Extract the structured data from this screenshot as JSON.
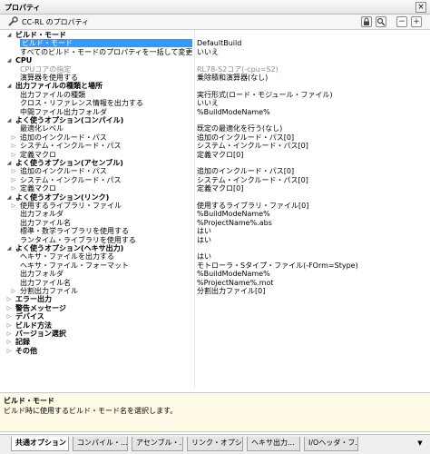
{
  "window": {
    "title": "プロパティ"
  },
  "toolbar": {
    "title": "CC-RL のプロパティ"
  },
  "rows": [
    {
      "type": "cat",
      "name": "ビルド・モード",
      "value": ""
    },
    {
      "type": "sel",
      "name": "ビルド・モード",
      "value": "DefaultBuild"
    },
    {
      "type": "item",
      "name": "すべてのビルド・モードのプロパティを一括して変更する",
      "value": "いいえ"
    },
    {
      "type": "cat",
      "name": "CPU",
      "value": ""
    },
    {
      "type": "grey",
      "name": "CPUコアの指定",
      "value": "RL78-S2コア(-cpu=S2)"
    },
    {
      "type": "item",
      "name": "演算器を使用する",
      "value": "乗除積和演算器(なし)"
    },
    {
      "type": "cat",
      "name": "出力ファイルの種類と場所",
      "value": ""
    },
    {
      "type": "item",
      "name": "出力ファイルの種類",
      "value": "実行形式(ロード・モジュール・ファイル)"
    },
    {
      "type": "item",
      "name": "クロス・リファレンス情報を出力する",
      "value": "いいえ"
    },
    {
      "type": "item",
      "name": "中間ファイル出力フォルダ",
      "value": "%BuildModeName%"
    },
    {
      "type": "cat",
      "name": "よく使うオプション(コンパイル)",
      "value": ""
    },
    {
      "type": "item",
      "name": "最適化レベル",
      "value": "既定の最適化を行う(なし)"
    },
    {
      "type": "child",
      "name": "追加のインクルード・パス",
      "value": "追加のインクルード・パス[0]"
    },
    {
      "type": "child",
      "name": "システム・インクルード・パス",
      "value": "システム・インクルード・パス[0]"
    },
    {
      "type": "child",
      "name": "定義マクロ",
      "value": "定義マクロ[0]"
    },
    {
      "type": "cat",
      "name": "よく使うオプション(アセンブル)",
      "value": ""
    },
    {
      "type": "child",
      "name": "追加のインクルード・パス",
      "value": "追加のインクルード・パス[0]"
    },
    {
      "type": "child",
      "name": "システム・インクルード・パス",
      "value": "システム・インクルード・パス[0]"
    },
    {
      "type": "child",
      "name": "定義マクロ",
      "value": "定義マクロ[0]"
    },
    {
      "type": "cat",
      "name": "よく使うオプション(リンク)",
      "value": ""
    },
    {
      "type": "child",
      "name": "使用するライブラリ・ファイル",
      "value": "使用するライブラリ・ファイル[0]"
    },
    {
      "type": "item",
      "name": "出力フォルダ",
      "value": "%BuildModeName%"
    },
    {
      "type": "item",
      "name": "出力ファイル名",
      "value": "%ProjectName%.abs"
    },
    {
      "type": "item",
      "name": "標準・数学ライブラリを使用する",
      "value": "はい"
    },
    {
      "type": "item",
      "name": "ランタイム・ライブラリを使用する",
      "value": "はい"
    },
    {
      "type": "cat",
      "name": "よく使うオプション(ヘキサ出力)",
      "value": ""
    },
    {
      "type": "item",
      "name": "ヘキサ・ファイルを出力する",
      "value": "はい"
    },
    {
      "type": "item",
      "name": "ヘキサ・ファイル・フォーマット",
      "value": "モトローラ・Sタイプ・ファイル(-FOrm=Stype)"
    },
    {
      "type": "item",
      "name": "出力フォルダ",
      "value": "%BuildModeName%"
    },
    {
      "type": "item",
      "name": "出力ファイル名",
      "value": "%ProjectName%.mot"
    },
    {
      "type": "child",
      "name": "分割出力ファイル",
      "value": "分割出力ファイル[0]"
    },
    {
      "type": "collapsed",
      "name": "エラー出力",
      "value": ""
    },
    {
      "type": "collapsed",
      "name": "警告メッセージ",
      "value": ""
    },
    {
      "type": "collapsed",
      "name": "デバイス",
      "value": ""
    },
    {
      "type": "collapsed",
      "name": "ビルド方法",
      "value": ""
    },
    {
      "type": "collapsed",
      "name": "バージョン選択",
      "value": ""
    },
    {
      "type": "collapsed",
      "name": "記録",
      "value": ""
    },
    {
      "type": "collapsed",
      "name": "その他",
      "value": ""
    }
  ],
  "description": {
    "title": "ビルド・モード",
    "text": "ビルド時に使用するビルド・モード名を選択します。"
  },
  "tabs": [
    {
      "label": "共通オプション",
      "active": true
    },
    {
      "label": "コンパイル・...",
      "active": false
    },
    {
      "label": "アセンブル・...",
      "active": false
    },
    {
      "label": "リンク・オプシ...",
      "active": false
    },
    {
      "label": "ヘキサ出力...",
      "active": false
    },
    {
      "label": "I/Oヘッダ・フ...",
      "active": false
    }
  ]
}
